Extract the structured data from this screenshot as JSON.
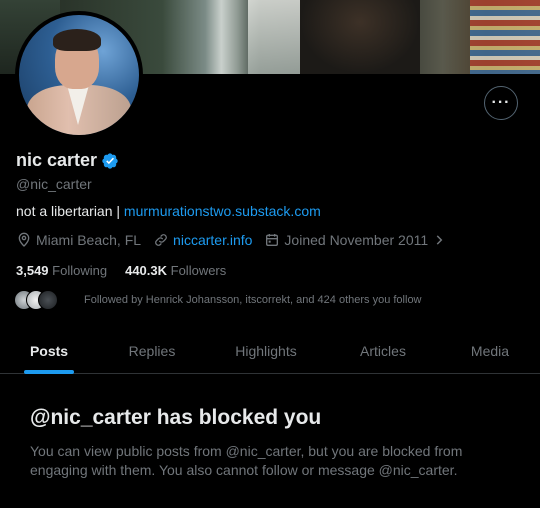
{
  "profile": {
    "name": "nic carter",
    "handle": "@nic_carter",
    "bio_text": "not a libertarian |",
    "bio_link": "murmurationstwo.substack.com",
    "location": "Miami Beach, FL",
    "website": "niccarter.info",
    "joined": "Joined November 2011",
    "following_count": "3,549",
    "following_label": "Following",
    "followers_count": "440.3K",
    "followers_label": "Followers",
    "followed_by": "Followed by Henrick Johansson, itscorrekt, and 424 others you follow"
  },
  "more_button": "···",
  "tabs": [
    {
      "label": "Posts",
      "active": true
    },
    {
      "label": "Replies",
      "active": false
    },
    {
      "label": "Highlights",
      "active": false
    },
    {
      "label": "Articles",
      "active": false
    },
    {
      "label": "Media",
      "active": false
    }
  ],
  "blocked": {
    "title": "@nic_carter has blocked you",
    "message": "You can view public posts from @nic_carter, but you are blocked from engaging with them. You also cannot follow or message @nic_carter."
  },
  "colors": {
    "accent": "#1d9bf0",
    "text": "#e7e9ea",
    "muted": "#71767b",
    "background": "#000000"
  },
  "icons": {
    "verified": "verified-badge-icon",
    "location": "location-pin-icon",
    "link": "link-icon",
    "calendar": "calendar-icon",
    "chevron": "chevron-right-icon",
    "more": "more-horizontal-icon"
  }
}
